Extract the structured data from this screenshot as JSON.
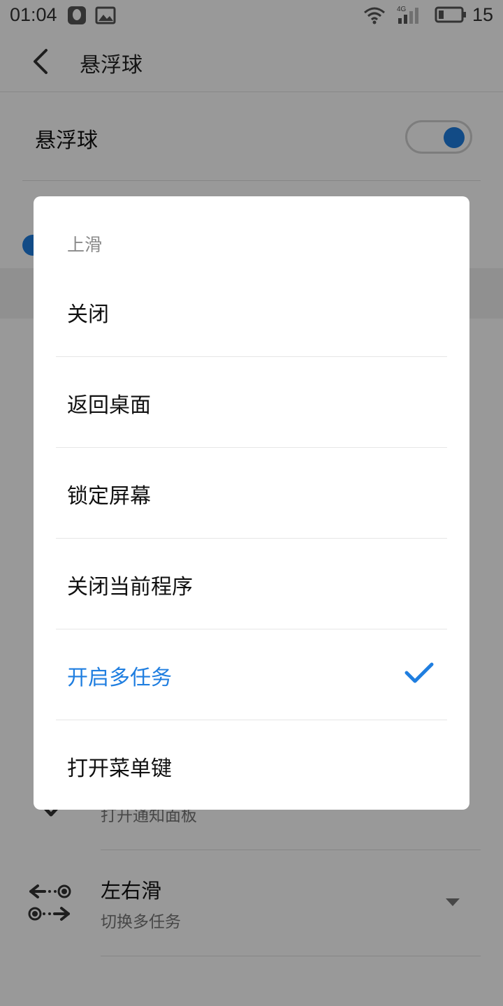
{
  "status_bar": {
    "time": "01:04",
    "network_label": "4G",
    "battery_level": "15",
    "icons": [
      "qq-icon",
      "gallery-icon",
      "wifi-icon",
      "signal-icon",
      "battery-icon"
    ]
  },
  "app_bar": {
    "title": "悬浮球",
    "back_icon": "chevron-left-icon"
  },
  "settings": {
    "toggle_label": "悬浮球",
    "toggle_on": true,
    "gesture_rows": [
      {
        "title": "",
        "subtitle": "打开通知面板",
        "icon": "swipe-down-icon"
      },
      {
        "title": "左右滑",
        "subtitle": "切换多任务",
        "icon": "swipe-left-right-icon"
      }
    ]
  },
  "dialog": {
    "title": "上滑",
    "options": [
      {
        "label": "关闭",
        "selected": false
      },
      {
        "label": "返回桌面",
        "selected": false
      },
      {
        "label": "锁定屏幕",
        "selected": false
      },
      {
        "label": "关闭当前程序",
        "selected": false
      },
      {
        "label": "开启多任务",
        "selected": true
      },
      {
        "label": "打开菜单键",
        "selected": false
      }
    ],
    "check_icon": "checkmark-icon"
  },
  "colors": {
    "accent": "#1f7ee0",
    "scrim": "rgba(0,0,0,0.40)"
  }
}
